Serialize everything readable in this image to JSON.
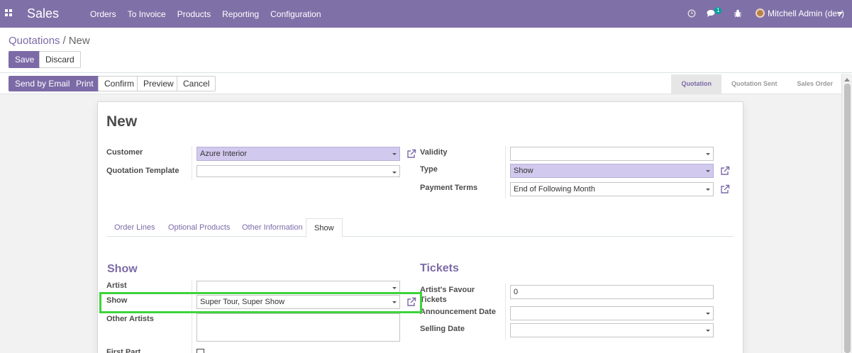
{
  "navbar": {
    "app_name": "Sales",
    "menu": [
      "Orders",
      "To Invoice",
      "Products",
      "Reporting",
      "Configuration"
    ],
    "chat_count": "1",
    "user": "Mitchell Admin (dev)",
    "icons": [
      "apps-grid-icon",
      "clock-icon",
      "chat-icon",
      "bug-icon",
      "chevron-down-icon"
    ],
    "colors": {
      "primary": "#8070a8",
      "link": "#7c6aa7"
    }
  },
  "breadcrumb": {
    "parent": "Quotations",
    "separator": "/",
    "current": "New"
  },
  "actions": {
    "save": "Save",
    "discard": "Discard"
  },
  "header_buttons": {
    "send_email": "Send by Email",
    "print": "Print",
    "confirm": "Confirm",
    "preview": "Preview",
    "cancel": "Cancel"
  },
  "stages": [
    "Quotation",
    "Quotation Sent",
    "Sales Order"
  ],
  "active_stage": "Quotation",
  "form": {
    "title": "New",
    "customer": {
      "label": "Customer",
      "value": "Azure Interior"
    },
    "quotation_template": {
      "label": "Quotation Template",
      "value": ""
    },
    "validity": {
      "label": "Validity",
      "value": ""
    },
    "type": {
      "label": "Type",
      "value": "Show"
    },
    "payment_terms": {
      "label": "Payment Terms",
      "value": "End of Following Month"
    }
  },
  "tabs": [
    "Order Lines",
    "Optional Products",
    "Other Information",
    "Show"
  ],
  "active_tab": "Show",
  "show_section": {
    "heading": "Show",
    "artist": {
      "label": "Artist",
      "value": ""
    },
    "show": {
      "label": "Show",
      "value": "Super Tour, Super Show"
    },
    "other_artists": {
      "label": "Other Artists"
    },
    "first_part": {
      "label": "First Part",
      "checked": false
    }
  },
  "tickets_section": {
    "heading": "Tickets",
    "artist_favour": {
      "label_line1": "Artist's Favour",
      "label_line2": "Tickets",
      "value": "0"
    },
    "announcement_date": {
      "label": "Announcement Date",
      "value": ""
    },
    "selling_date": {
      "label": "Selling Date",
      "value": ""
    }
  }
}
